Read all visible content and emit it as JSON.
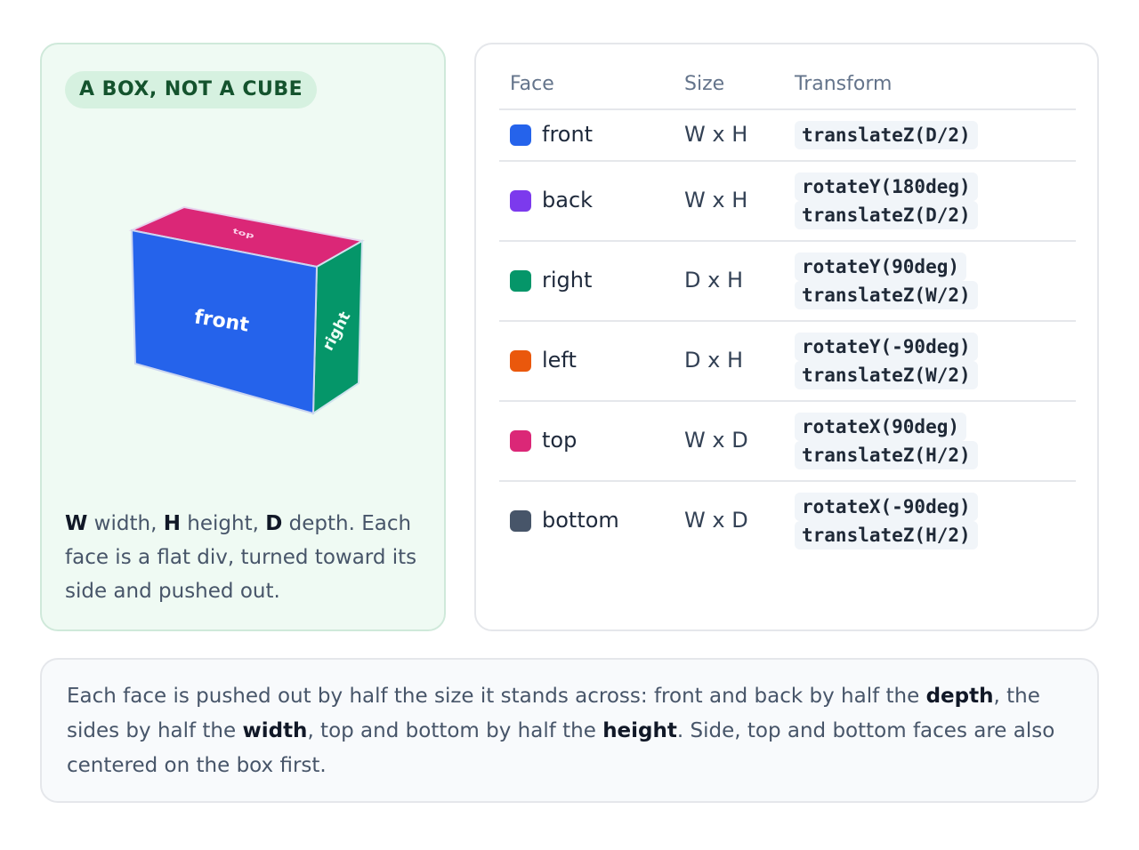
{
  "box_card": {
    "badge": "A BOX, NOT A CUBE",
    "box_labels": {
      "front": "front",
      "top": "top",
      "right": "right"
    },
    "caption": {
      "w_key": "W",
      "w_text": " width, ",
      "h_key": "H",
      "h_text": " height, ",
      "d_key": "D",
      "d_text": " depth. Each face is a flat div, turned toward its side and pushed out."
    }
  },
  "table": {
    "headers": {
      "face": "Face",
      "size": "Size",
      "transform": "Transform"
    },
    "rows": [
      {
        "face": "front",
        "color": "#2563eb",
        "size": "W x H",
        "transforms": [
          "translateZ(D/2)"
        ]
      },
      {
        "face": "back",
        "color": "#7c3aed",
        "size": "W x H",
        "transforms": [
          "rotateY(180deg)",
          "translateZ(D/2)"
        ]
      },
      {
        "face": "right",
        "color": "#059669",
        "size": "D x H",
        "transforms": [
          "rotateY(90deg)",
          "translateZ(W/2)"
        ]
      },
      {
        "face": "left",
        "color": "#ea580c",
        "size": "D x H",
        "transforms": [
          "rotateY(-90deg)",
          "translateZ(W/2)"
        ]
      },
      {
        "face": "top",
        "color": "#db2777",
        "size": "W x D",
        "transforms": [
          "rotateX(90deg)",
          "translateZ(H/2)"
        ]
      },
      {
        "face": "bottom",
        "color": "#475569",
        "size": "W x D",
        "transforms": [
          "rotateX(-90deg)",
          "translateZ(H/2)"
        ]
      }
    ]
  },
  "note": {
    "p1": "Each face is pushed out by half the size it stands across: front and back by half the ",
    "b1": "depth",
    "p2": ", the sides by half the ",
    "b2": "width",
    "p3": ", top and bottom by half the ",
    "b3": "height",
    "p4": ". Side, top and bottom faces are also centered on the box first."
  },
  "colors": {
    "front_face": "#2563eb",
    "top_face": "#db2777",
    "right_face": "#059669",
    "left_card_bg": "#effaf3",
    "badge_bg": "#d6f1e0",
    "badge_text": "#14532d"
  }
}
